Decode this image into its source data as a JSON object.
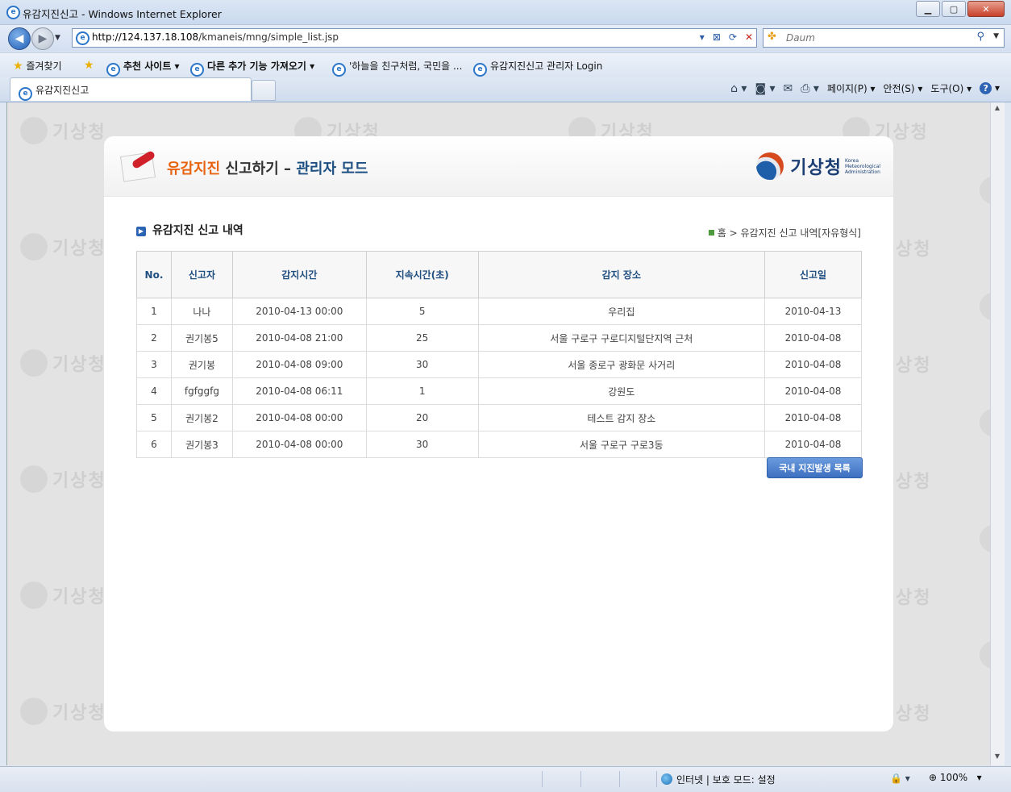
{
  "window": {
    "title": "유감지진신고 - Windows Internet Explorer"
  },
  "nav": {
    "url_host": "http://124.137.18.108",
    "url_path": "/kmaneis/mng/simple_list.jsp",
    "search_provider": "Daum"
  },
  "favorites_bar": {
    "favorites_label": "즐겨찾기",
    "items": [
      "추천 사이트 ▾",
      "다른 추가 기능 가져오기 ▾",
      "'하늘을 친구처럼, 국민을 ...",
      "유감지진신고 관리자 Login"
    ]
  },
  "tab": {
    "active_title": "유감지진신고"
  },
  "command_bar": {
    "page": "페이지(P)",
    "safety": "안전(S)",
    "tools": "도구(O)"
  },
  "watermark": {
    "text": "기상청",
    "partial": "상청",
    "small": "Korea Meteorological Administration"
  },
  "page": {
    "title_orange": "유감지진",
    "title_mid": "신고하기 –",
    "title_blue": "관리자 모드",
    "logo_text": "기상청",
    "logo_en": "Korea Meteorological Administration",
    "section_title": "유감지진 신고 내역",
    "breadcrumb_home": "홈",
    "breadcrumb_current": "유감지진 신고 내역[자유형식]",
    "list_button": "국내 지진발생 목록"
  },
  "table": {
    "headers": [
      "No.",
      "신고자",
      "감지시간",
      "지속시간(초)",
      "감지 장소",
      "신고일"
    ],
    "rows": [
      [
        "1",
        "나나",
        "2010-04-13 00:00",
        "5",
        "우리집",
        "2010-04-13"
      ],
      [
        "2",
        "권기봉5",
        "2010-04-08 21:00",
        "25",
        "서울 구로구 구로디지털단지역 근처",
        "2010-04-08"
      ],
      [
        "3",
        "권기봉",
        "2010-04-08 09:00",
        "30",
        "서울 종로구 광화문 사거리",
        "2010-04-08"
      ],
      [
        "4",
        "fgfggfg",
        "2010-04-08 06:11",
        "1",
        "강원도",
        "2010-04-08"
      ],
      [
        "5",
        "권기봉2",
        "2010-04-08 00:00",
        "20",
        "테스트 감지 장소",
        "2010-04-08"
      ],
      [
        "6",
        "권기봉3",
        "2010-04-08 00:00",
        "30",
        "서울 구로구 구로3동",
        "2010-04-08"
      ]
    ]
  },
  "status": {
    "zone": "인터넷 | 보호 모드: 설정",
    "zoom": "100%"
  }
}
